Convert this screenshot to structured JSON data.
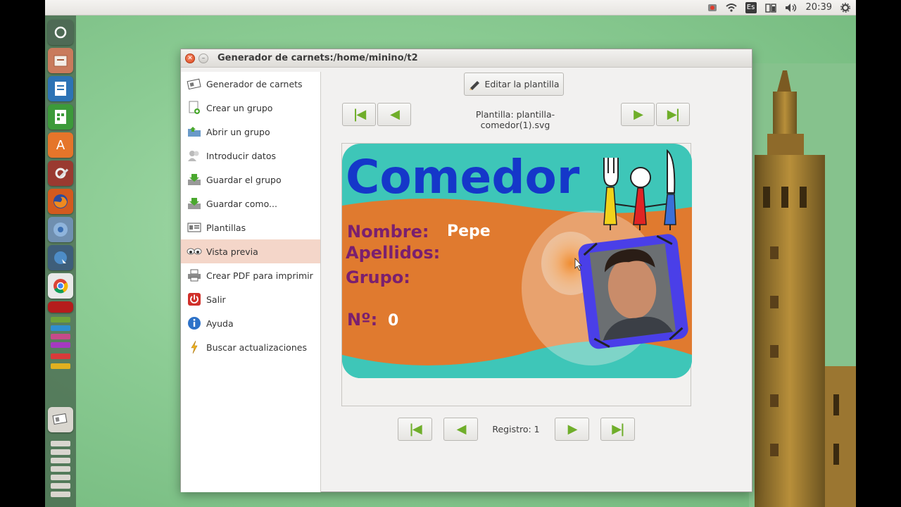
{
  "top_panel": {
    "keyboard_layout": "Es",
    "time": "20:39",
    "icons": [
      "record-icon",
      "wifi-icon",
      "keyboard-icon",
      "battery-icon",
      "volume-icon",
      "settings-icon"
    ]
  },
  "launcher": {
    "items": [
      "dash-icon",
      "files-icon",
      "writer-icon",
      "calc-icon",
      "software-center-icon",
      "system-settings-icon",
      "firefox-icon",
      "chromium-icon",
      "network-icon",
      "chrome-icon",
      "opera-icon",
      "app-icon",
      "app-icon",
      "app-icon",
      "app-icon",
      "carnets-app-icon",
      "workspaces-icon"
    ]
  },
  "window": {
    "title": "Generador de carnets:/home/minino/t2"
  },
  "sidebar": {
    "items": [
      {
        "label": "Generador de carnets",
        "icon": "id-cards-icon"
      },
      {
        "label": "Crear un grupo",
        "icon": "new-document-icon"
      },
      {
        "label": "Abrir un grupo",
        "icon": "open-folder-icon"
      },
      {
        "label": "Introducir datos",
        "icon": "users-icon"
      },
      {
        "label": "Guardar el grupo",
        "icon": "save-icon"
      },
      {
        "label": "Guardar como...",
        "icon": "save-as-icon"
      },
      {
        "label": "Plantillas",
        "icon": "template-icon"
      },
      {
        "label": "Vista previa",
        "icon": "eyes-icon"
      },
      {
        "label": "Crear PDF para imprimir",
        "icon": "printer-icon"
      },
      {
        "label": "Salir",
        "icon": "power-icon"
      },
      {
        "label": "Ayuda",
        "icon": "info-icon"
      },
      {
        "label": "Buscar actualizaciones",
        "icon": "lightning-icon"
      }
    ],
    "active_index": 7
  },
  "main": {
    "edit_template_label": "Editar la plantilla",
    "template_label": "Plantilla: plantilla-comedor(1).svg",
    "record_label": "Registro: 1"
  },
  "card": {
    "title": "Comedor",
    "name_label": "Nombre:",
    "name_value": "Pepe",
    "surname_label": "Apellidos:",
    "group_label": "Grupo:",
    "number_label": "Nº:",
    "number_value": "0",
    "colors": {
      "teal": "#3ec6b8",
      "orange": "#e07a2f",
      "title_blue": "#1537c9",
      "label_purple": "#7a1f6f",
      "photo_frame": "#4a3fe8"
    }
  },
  "colors": {
    "accent_green": "#6fae2a",
    "active_row": "#f4d6c9",
    "desktop_green": "#8ccc94"
  }
}
